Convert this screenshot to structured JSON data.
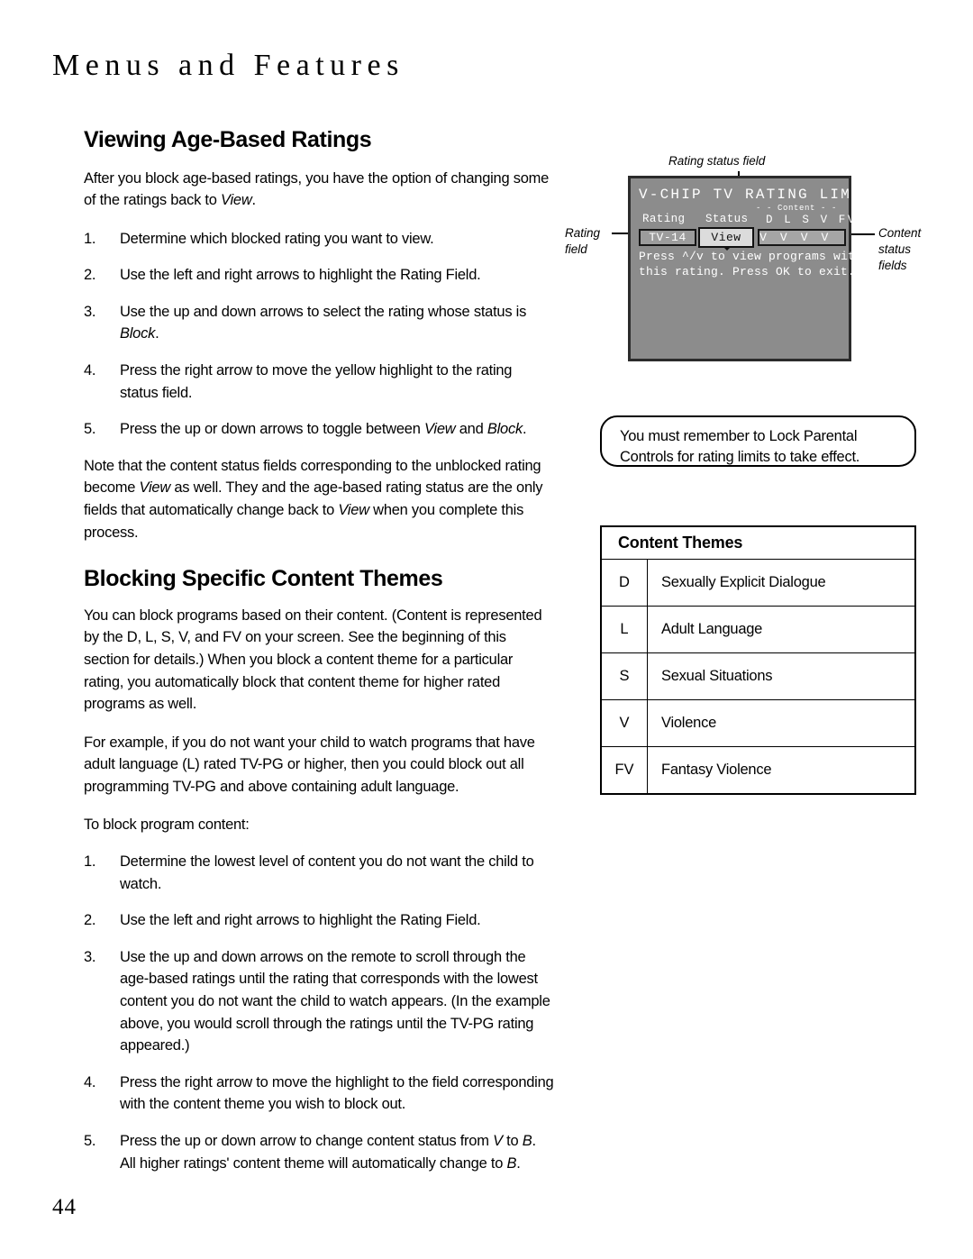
{
  "page": {
    "running_head": "Menus and Features",
    "folio": "44"
  },
  "left_column": {
    "section1": {
      "title": "Viewing Age-Based Ratings",
      "intro_a": "After you block age-based ratings, you have the option of changing some of the ratings back to ",
      "intro_italic": "View",
      "intro_b": ".",
      "steps": [
        {
          "num": "1.",
          "text": "Determine which blocked rating you want to view."
        },
        {
          "num": "2.",
          "text": "Use the left and right arrows to highlight the Rating Field."
        },
        {
          "num": "3.",
          "text_a": "Use the up and down arrows to select the rating whose status is ",
          "italic": "Block",
          "text_b": "."
        },
        {
          "num": "4.",
          "text": "Press the right arrow to move the yellow highlight to the rating status field."
        },
        {
          "num": "5.",
          "text_a": "Press the up or down arrows to toggle between ",
          "italic": "View",
          "text_b": " and ",
          "italic2": "Block",
          "text_c": "."
        }
      ],
      "note_a": "Note that the content status fields corresponding to the unblocked rating become ",
      "note_i1": "View",
      "note_b": " as well. They and the age-based rating status are the only fields that automatically change back to ",
      "note_i2": "View",
      "note_c": " when you complete this process."
    },
    "section2": {
      "title": "Blocking Specific Content Themes",
      "para1": "You can block programs based on their content. (Content is represented by the D, L, S, V, and FV on your screen. See the beginning of this section for details.) When you block a content theme for a particular rating, you automatically block that content theme for higher rated programs as well.",
      "para2": "For example, if you do not want your child to watch programs that have adult language (L) rated TV-PG or higher, then you could block out all programming TV-PG and above containing adult language.",
      "para3": "To block program content:",
      "steps": [
        {
          "num": "1.",
          "text": "Determine the lowest level of content you do not want the child to watch."
        },
        {
          "num": "2.",
          "text": "Use the left and right arrows to highlight the Rating Field."
        },
        {
          "num": "3.",
          "text": "Use the up and down arrows on the remote to scroll through the age-based ratings until the rating that corresponds with the lowest content you do not want the child to watch appears. (In the example above, you would scroll through the ratings until the TV-PG rating appeared.)"
        },
        {
          "num": "4.",
          "text": "Press the right arrow to move the highlight to the field corresponding with the content theme you wish to block out."
        },
        {
          "num": "5.",
          "text_a": "Press the up or down arrow to change content status from ",
          "italic": "V",
          "text_b": " to ",
          "italic2": "B",
          "text_c": ". All higher ratings' content theme will automatically change to ",
          "italic3": "B",
          "text_d": "."
        }
      ]
    }
  },
  "figure": {
    "callout_top": "Rating status field",
    "callout_left_line1": "Rating",
    "callout_left_line2": "field",
    "callout_right_line1": "Content",
    "callout_right_line2": "status",
    "callout_right_line3": "fields",
    "osd": {
      "title": "V-CHIP TV RATING LIMIT",
      "content_caption": "- - Content - -",
      "header_rating": "Rating",
      "header_status": "Status",
      "header_letters": "D L S V FV",
      "rating_value": "TV-14",
      "status_value": "View",
      "content_values": "V V V V",
      "help_line1": "Press ^/v to view programs with",
      "help_line2": "this rating. Press OK to exit."
    },
    "screen_color": "#8c8c8c",
    "bezel_color": "#2b2b2b",
    "highlight_color": "#dcdcdc"
  },
  "note_bubble": {
    "line1": "You must remember to Lock Parental",
    "line2": "Controls for rating limits to take effect."
  },
  "themes_table": {
    "header": "Content Themes",
    "rows": [
      {
        "code": "D",
        "label": "Sexually Explicit Dialogue"
      },
      {
        "code": "L",
        "label": "Adult Language"
      },
      {
        "code": "S",
        "label": "Sexual Situations"
      },
      {
        "code": "V",
        "label": "Violence"
      },
      {
        "code": "FV",
        "label": "Fantasy Violence"
      }
    ]
  }
}
